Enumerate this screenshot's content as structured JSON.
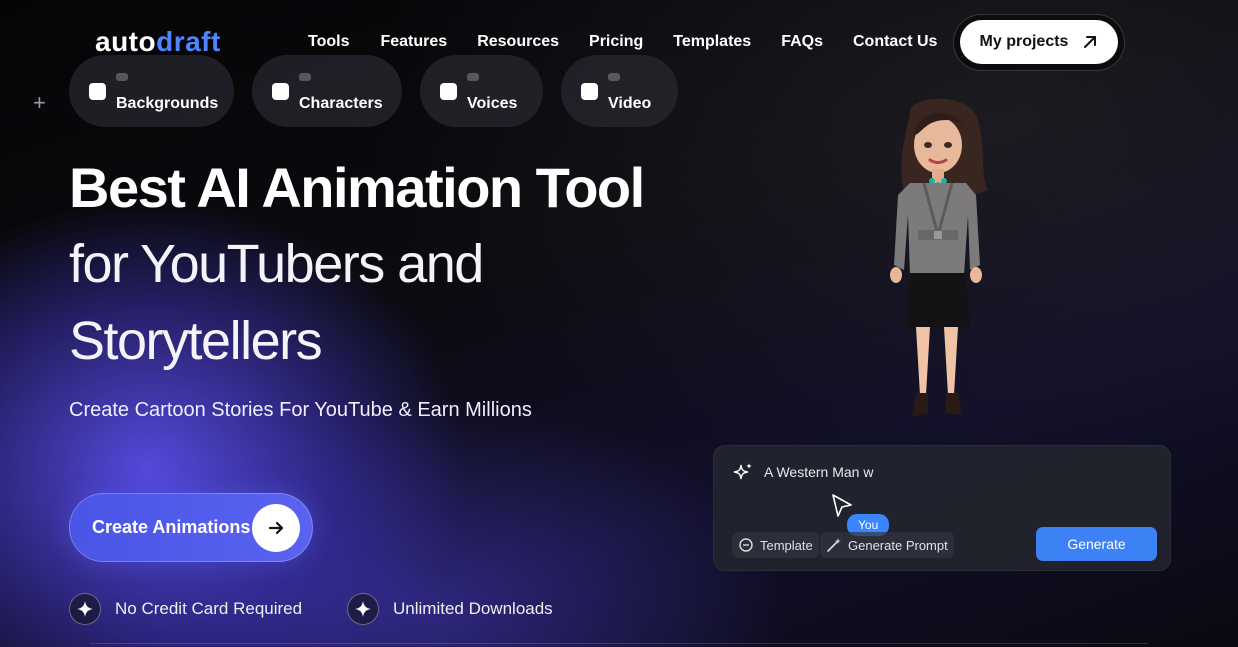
{
  "brand": {
    "logo_part1": "auto",
    "logo_part2": "draft"
  },
  "nav": {
    "items": [
      "Tools",
      "Features",
      "Resources",
      "Pricing",
      "Templates",
      "FAQs",
      "Contact Us"
    ],
    "cta": "My projects"
  },
  "categories": [
    {
      "label": "Backgrounds",
      "icon": "image-icon"
    },
    {
      "label": "Characters",
      "icon": "walking-figure-icon"
    },
    {
      "label": "Voices",
      "icon": "music-note-icon"
    },
    {
      "label": "Video",
      "icon": "video-play-icon"
    }
  ],
  "hero": {
    "line1": "Best AI Animation Tool",
    "line2": "for YouTubers and",
    "line3": "Storytellers",
    "subtitle": "Create Cartoon Stories For YouTube & Earn Millions",
    "cta": "Create Animations"
  },
  "features": [
    "No Credit Card Required",
    "Unlimited Downloads"
  ],
  "prompt_panel": {
    "text": "A Western Man w",
    "cursor_label": "You",
    "template_label": "Template",
    "generate_prompt_label": "Generate Prompt",
    "generate_button": "Generate"
  },
  "colors": {
    "accent": "#4f86ff",
    "cta_gradient_start": "#4a55e6",
    "generate": "#3d82f5"
  }
}
